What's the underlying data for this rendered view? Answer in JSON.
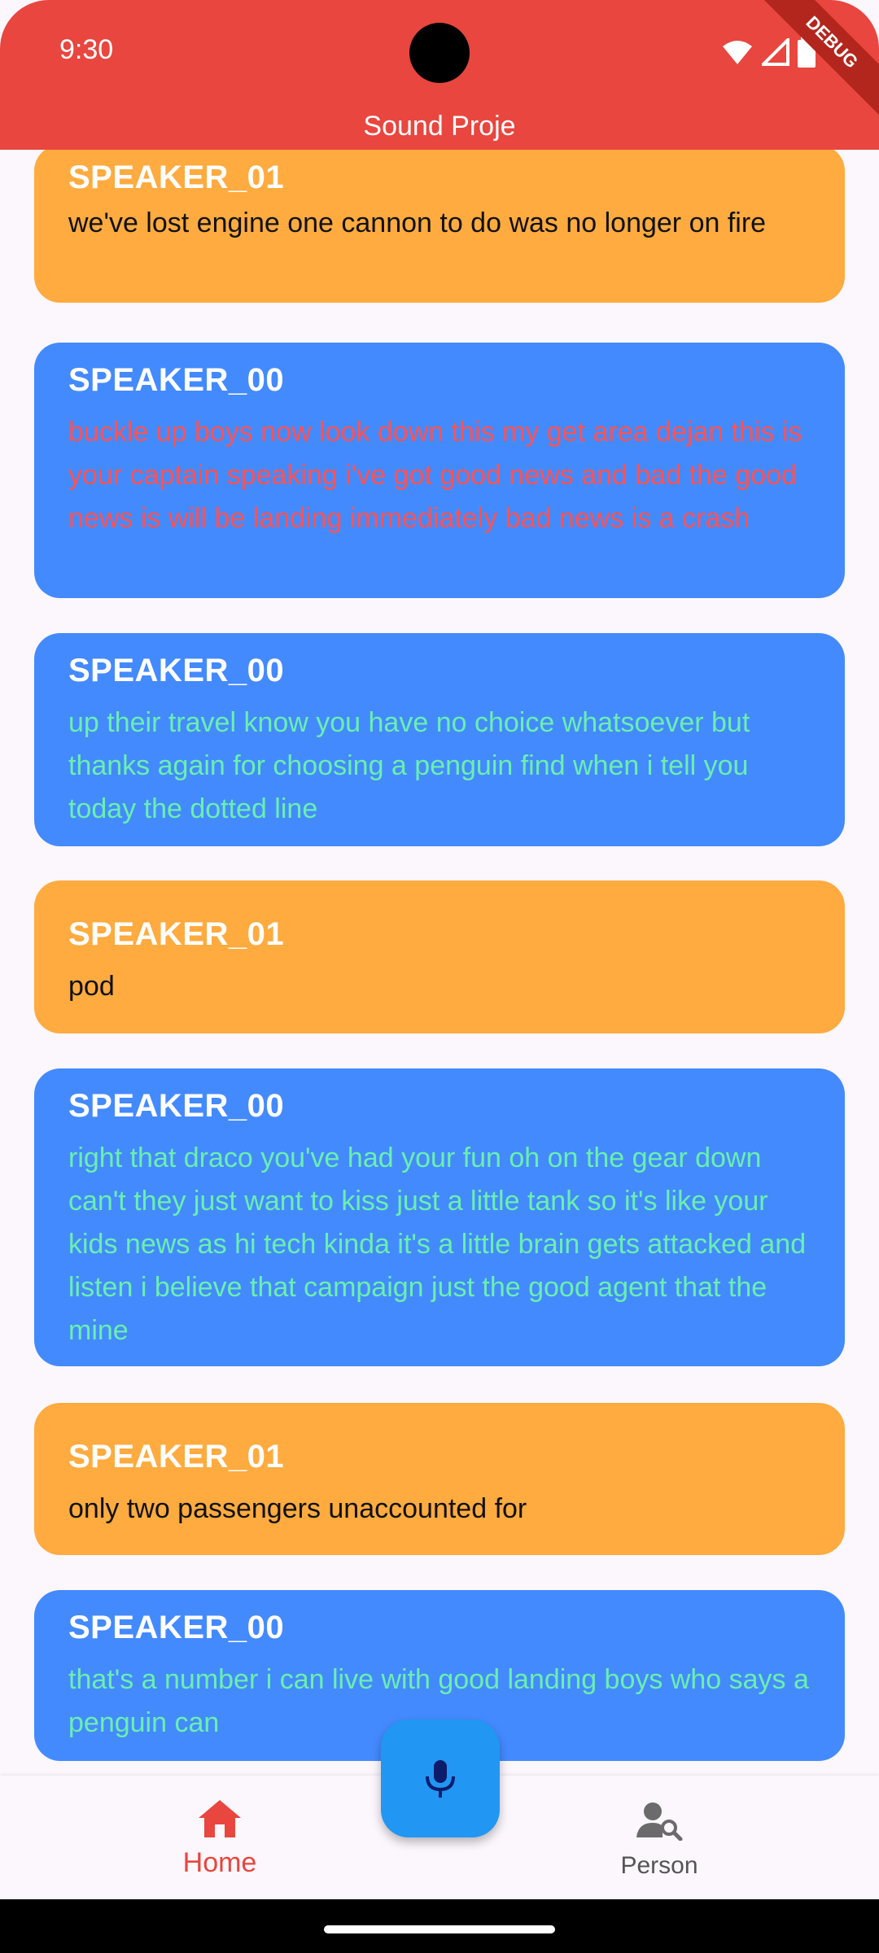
{
  "status_bar": {
    "time": "9:30"
  },
  "app": {
    "title": "Sound Proje",
    "debug_banner": "DEBUG"
  },
  "messages": [
    {
      "speaker": "SPEAKER_01",
      "text": "we've lost engine one cannon to do was no longer on fire",
      "color": "#ffab40",
      "text_color": "#111111"
    },
    {
      "speaker": "SPEAKER_00",
      "text": "buckle up boys now look down this my get area dejan this is your captain speaking i've got good news and bad the good news is will be landing immediately bad news is a crash",
      "color": "#448aff",
      "text_color": "#ff5252"
    },
    {
      "speaker": "SPEAKER_00",
      "text": "up their travel know you have no choice whatsoever but thanks again for choosing a penguin find when i tell you today the dotted line",
      "color": "#448aff",
      "text_color": "#69f0ae"
    },
    {
      "speaker": "SPEAKER_01",
      "text": "pod",
      "color": "#ffab40",
      "text_color": "#111111"
    },
    {
      "speaker": "SPEAKER_00",
      "text": "right that draco you've had your fun oh on the gear down can't they just want to kiss just a little tank so it's like your kids news as hi tech kinda it's a little brain gets attacked and listen i believe that campaign just the good agent that the mine",
      "color": "#448aff",
      "text_color": "#69f0ae"
    },
    {
      "speaker": "SPEAKER_01",
      "text": "only two passengers unaccounted for",
      "color": "#ffab40",
      "text_color": "#111111"
    },
    {
      "speaker": "SPEAKER_00",
      "text": "that's a number i can live with good landing boys who says a penguin can",
      "color": "#448aff",
      "text_color": "#69f0ae"
    }
  ],
  "bottom_nav": {
    "items": [
      {
        "label": "Home",
        "icon": "home-icon",
        "active": true
      },
      {
        "label": "Person",
        "icon": "person-search-icon",
        "active": false
      }
    ],
    "fab_icon": "mic-icon"
  },
  "colors": {
    "app_bar": "#e8463f",
    "fab": "#2196f3",
    "active_nav": "#e8463f"
  }
}
